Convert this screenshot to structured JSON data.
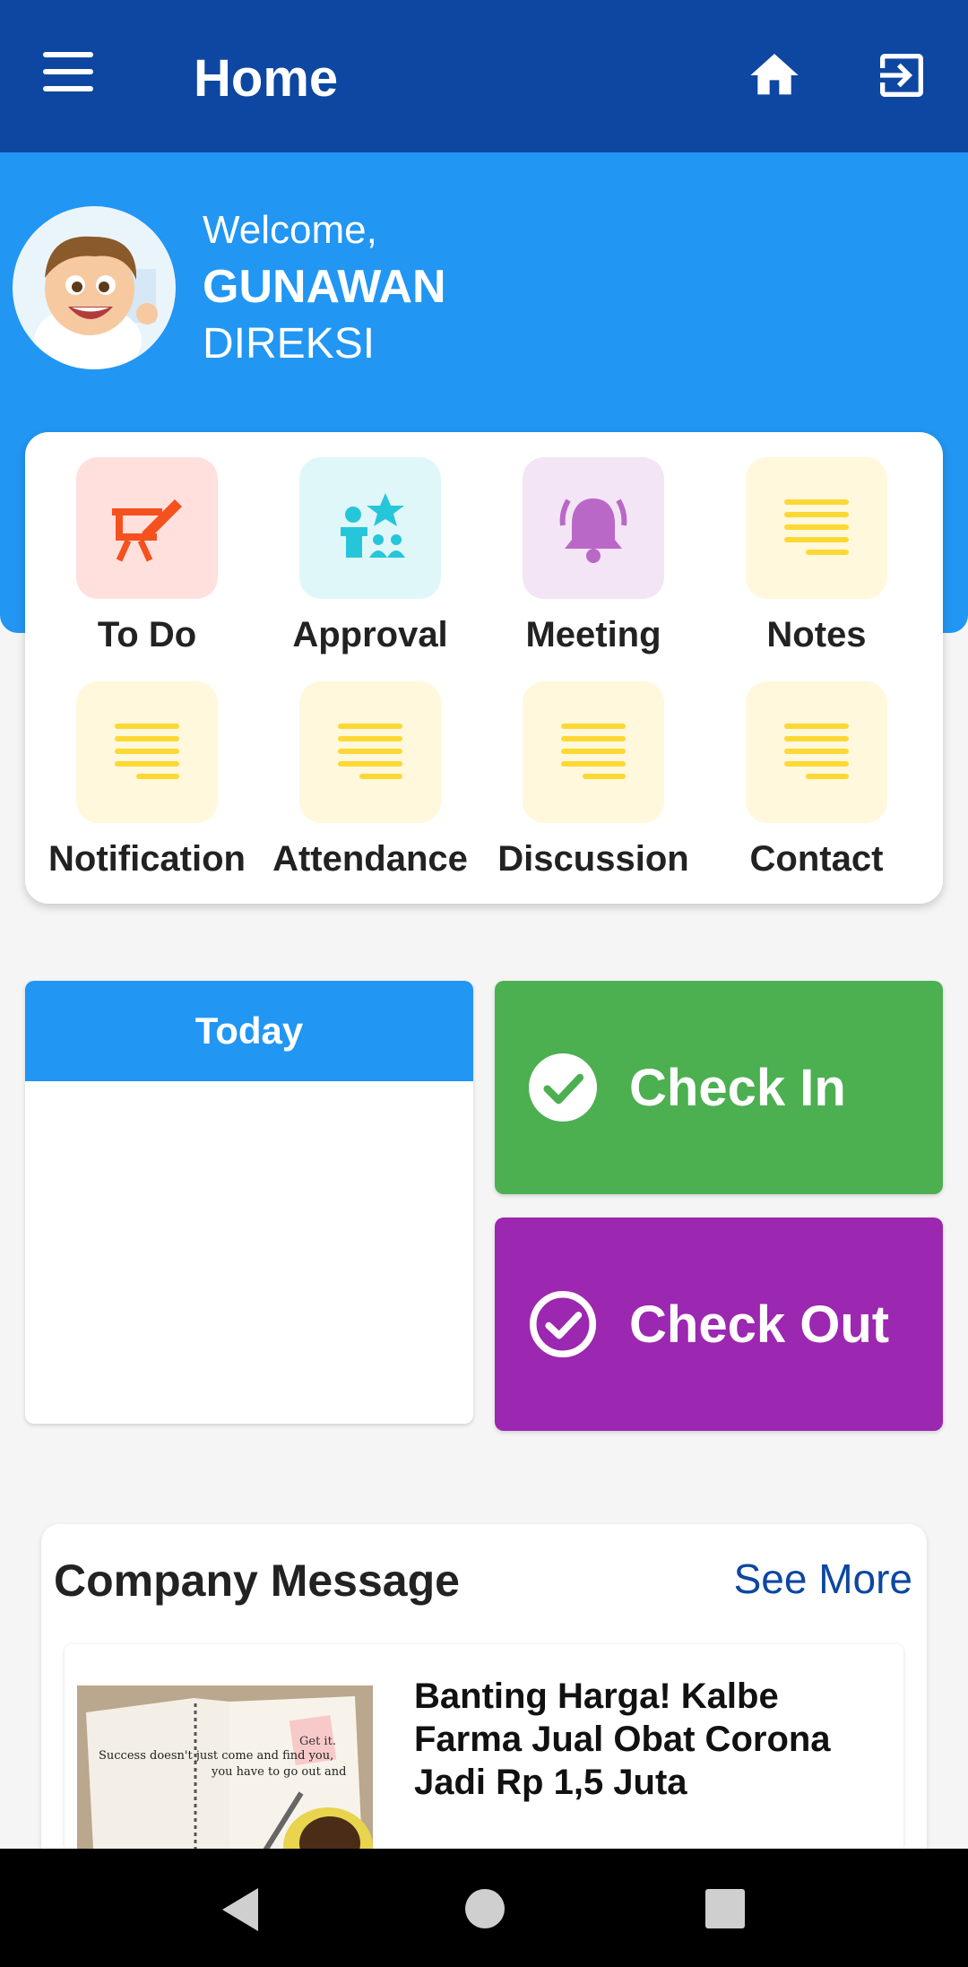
{
  "appbar": {
    "title": "Home",
    "icons": [
      "menu-icon",
      "home-icon",
      "logout-icon"
    ]
  },
  "profile": {
    "greeting": "Welcome,",
    "name": "GUNAWAN",
    "role": "DIREKSI"
  },
  "menu": [
    {
      "label": "To Do",
      "icon": "presentation-icon",
      "color": "#f4511e",
      "bg": "#ffe0dc"
    },
    {
      "label": "Approval",
      "icon": "approval-icon",
      "color": "#26c6da",
      "bg": "#e0f7fa"
    },
    {
      "label": "Meeting",
      "icon": "bell-icon",
      "color": "#ba68c8",
      "bg": "#f3e5f5"
    },
    {
      "label": "Notes",
      "icon": "notes-icon",
      "color": "#fdd835",
      "bg": "#fff8dc"
    },
    {
      "label": "Notification",
      "icon": "notes-icon",
      "color": "#fdd835",
      "bg": "#fff8dc"
    },
    {
      "label": "Attendance",
      "icon": "notes-icon",
      "color": "#fdd835",
      "bg": "#fff8dc"
    },
    {
      "label": "Discussion",
      "icon": "notes-icon",
      "color": "#fdd835",
      "bg": "#fff8dc"
    },
    {
      "label": "Contact",
      "icon": "notes-icon",
      "color": "#fdd835",
      "bg": "#fff8dc"
    }
  ],
  "today": {
    "label": "Today"
  },
  "actions": {
    "check_in": "Check In",
    "check_out": "Check Out",
    "check_in_color": "#4caf50",
    "check_out_color": "#9c27b0"
  },
  "company": {
    "title": "Company Message",
    "see_more": "See More",
    "news": [
      {
        "headline": "Banting Harga! Kalbe Farma Jual Obat Corona Jadi Rp 1,5 Juta",
        "thumb_notes": [
          "Success doesn't just come and find you,",
          "you have to go out and",
          "Get it."
        ]
      }
    ]
  },
  "colors": {
    "primary_dark": "#0d47a1",
    "primary": "#2196f3"
  }
}
